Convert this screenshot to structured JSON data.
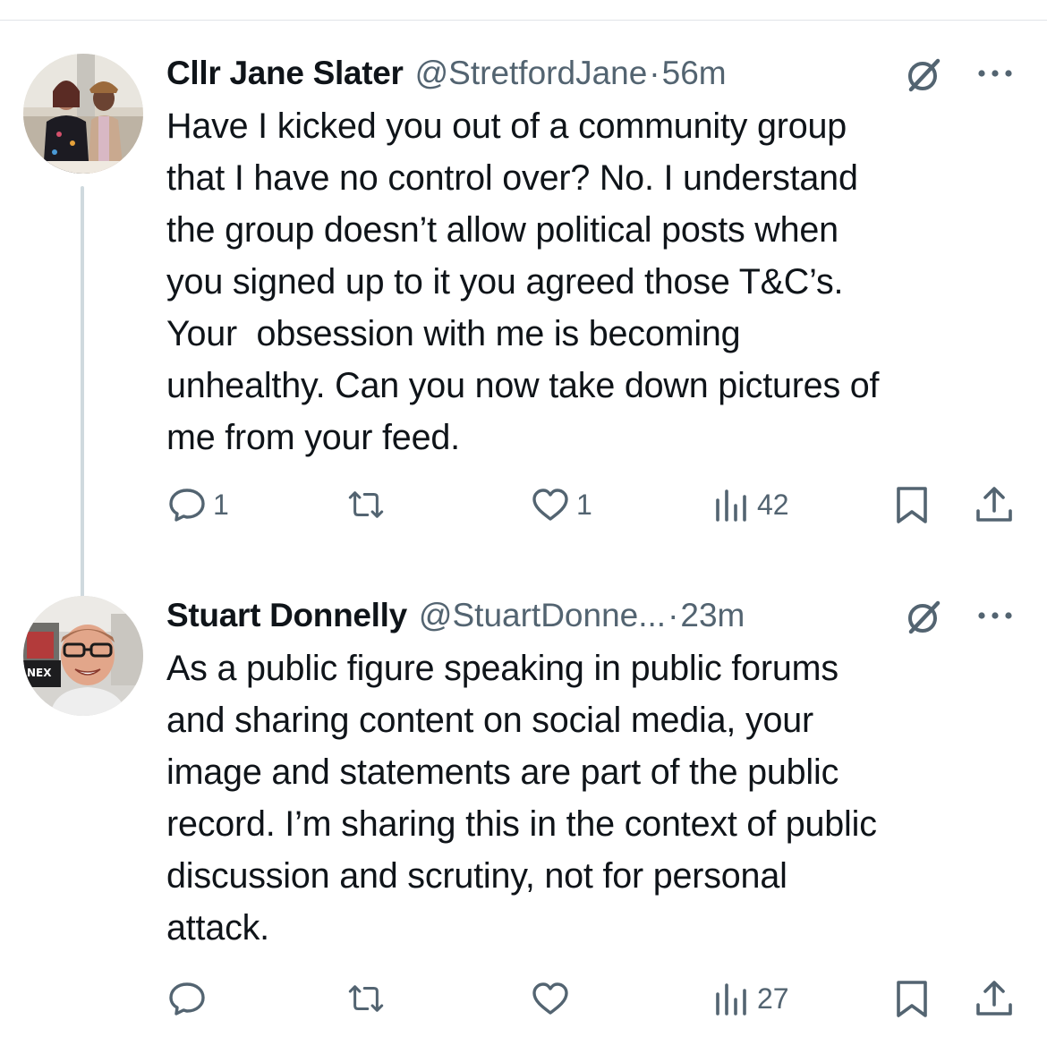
{
  "tweets": [
    {
      "name": "Cllr Jane Slater",
      "handle": "@StretfordJane",
      "separator": "·",
      "time": "56m",
      "text": "Have I kicked you out of a community group\nthat I have no control over? No. I understand\nthe group doesn’t allow political posts when\nyou signed up to it you agreed those T&C’s.\nYour  obsession with me is becoming\nunhealthy. Can you now take down pictures of\nme from your feed.",
      "replies": "1",
      "retweets": "",
      "likes": "1",
      "views": "42"
    },
    {
      "name": "Stuart Donnelly",
      "handle": "@StuartDonne...",
      "separator": "·",
      "time": "23m",
      "text": "As a public figure speaking in public forums\nand sharing content on social media, your\nimage and statements are part of the public\nrecord. I’m sharing this in the context of public\ndiscussion and scrutiny, not for personal\nattack.",
      "replies": "",
      "retweets": "",
      "likes": "",
      "views": "27"
    }
  ],
  "icons": {
    "reply": "speech-bubble-icon",
    "retweet": "retweet-icon",
    "like": "heart-icon",
    "views": "bar-chart-icon",
    "bookmark": "bookmark-icon",
    "share": "share-upload-icon",
    "grok": "grok-icon",
    "more": "more-dots-icon"
  },
  "colors": {
    "text": "#0f1419",
    "secondary": "#536471",
    "thread_line": "#cfd9de"
  }
}
